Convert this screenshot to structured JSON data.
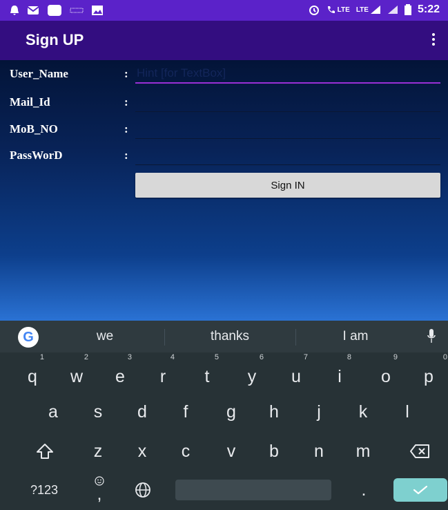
{
  "status_bar": {
    "time": "5:22",
    "net1": "LTE",
    "net2": "LTE",
    "icons": [
      "notification-icon",
      "message-icon",
      "app-icon",
      "voicemail-icon",
      "image-icon",
      "alarm-icon",
      "call-lte-icon",
      "signal-icon",
      "signal-icon-2",
      "battery-icon"
    ]
  },
  "app_bar": {
    "title": "Sign UP",
    "background": "#330d80",
    "status_background": "#5b22c9"
  },
  "form": {
    "fields": [
      {
        "label": "User_Name",
        "colon": ":",
        "placeholder": "Hint [for TextBox]",
        "value": ""
      },
      {
        "label": "Mail_Id",
        "colon": ":",
        "placeholder": "",
        "value": ""
      },
      {
        "label": "MoB_NO",
        "colon": ":",
        "placeholder": "",
        "value": ""
      },
      {
        "label": "PassWorD",
        "colon": ":",
        "placeholder": "",
        "value": ""
      }
    ],
    "button_label": "Sign IN"
  },
  "keyboard": {
    "suggestions": [
      "we",
      "thanks",
      "I am"
    ],
    "row1": [
      {
        "key": "q",
        "hint": "1"
      },
      {
        "key": "w",
        "hint": "2"
      },
      {
        "key": "e",
        "hint": "3"
      },
      {
        "key": "r",
        "hint": "4"
      },
      {
        "key": "t",
        "hint": "5"
      },
      {
        "key": "y",
        "hint": "6"
      },
      {
        "key": "u",
        "hint": "7"
      },
      {
        "key": "i",
        "hint": "8"
      },
      {
        "key": "o",
        "hint": "9"
      },
      {
        "key": "p",
        "hint": "0"
      }
    ],
    "row2": [
      "a",
      "s",
      "d",
      "f",
      "g",
      "h",
      "j",
      "k",
      "l"
    ],
    "row3": [
      "z",
      "x",
      "c",
      "v",
      "b",
      "n",
      "m"
    ],
    "symbols_label": "?123",
    "comma_label": ",",
    "period_label": ".",
    "shift_icon": "shift-icon",
    "backspace_icon": "backspace-icon",
    "globe_icon": "globe-icon",
    "enter_icon": "checkmark-icon",
    "accent_color": "#7ed0cf"
  }
}
